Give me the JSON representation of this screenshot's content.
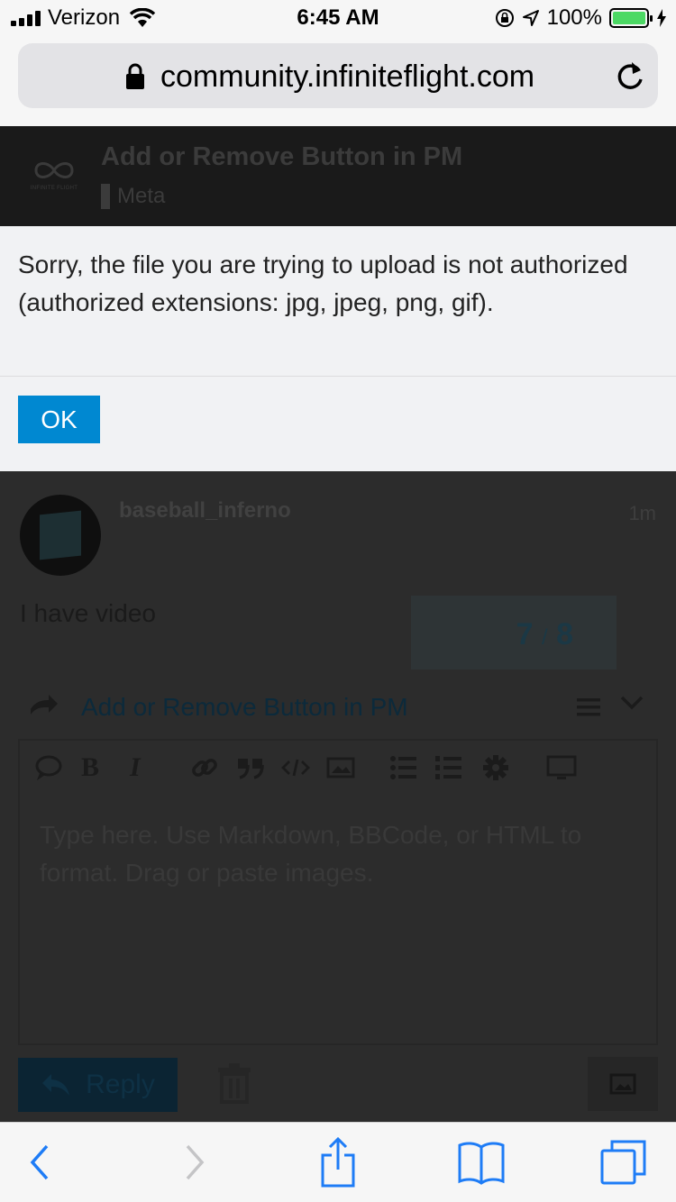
{
  "status_bar": {
    "carrier": "Verizon",
    "time": "6:45 AM",
    "battery_percent": "100%",
    "battery_color": "#4cd964"
  },
  "browser": {
    "url": "community.infiniteflight.com"
  },
  "site_header": {
    "logo_caption": "INFINITE FLIGHT",
    "topic_title": "Add or Remove Button in PM",
    "category": "Meta"
  },
  "modal": {
    "message": "Sorry, the file you are trying to upload is not authorized (authorized extensions: jpg, jpeg, png, gif).",
    "ok_label": "OK",
    "accent_color": "#0088d1"
  },
  "post": {
    "username": "baseball_inferno",
    "age": "1m",
    "body": "I have video"
  },
  "progress": {
    "current": "7",
    "separator": "/",
    "total": "8"
  },
  "composer": {
    "reply_title": "Add or Remove Button in PM",
    "placeholder": "Type here. Use Markdown, BBCode, or HTML to format. Drag or paste images.",
    "toolbar_icons": [
      "quote-icon",
      "bold-icon",
      "italic-icon",
      "link-icon",
      "blockquote-icon",
      "code-icon",
      "image-icon",
      "bullet-list-icon",
      "numbered-list-icon",
      "gear-icon",
      "preview-icon"
    ],
    "bold_glyph": "B",
    "italic_glyph": "I",
    "reply_label": "Reply"
  }
}
